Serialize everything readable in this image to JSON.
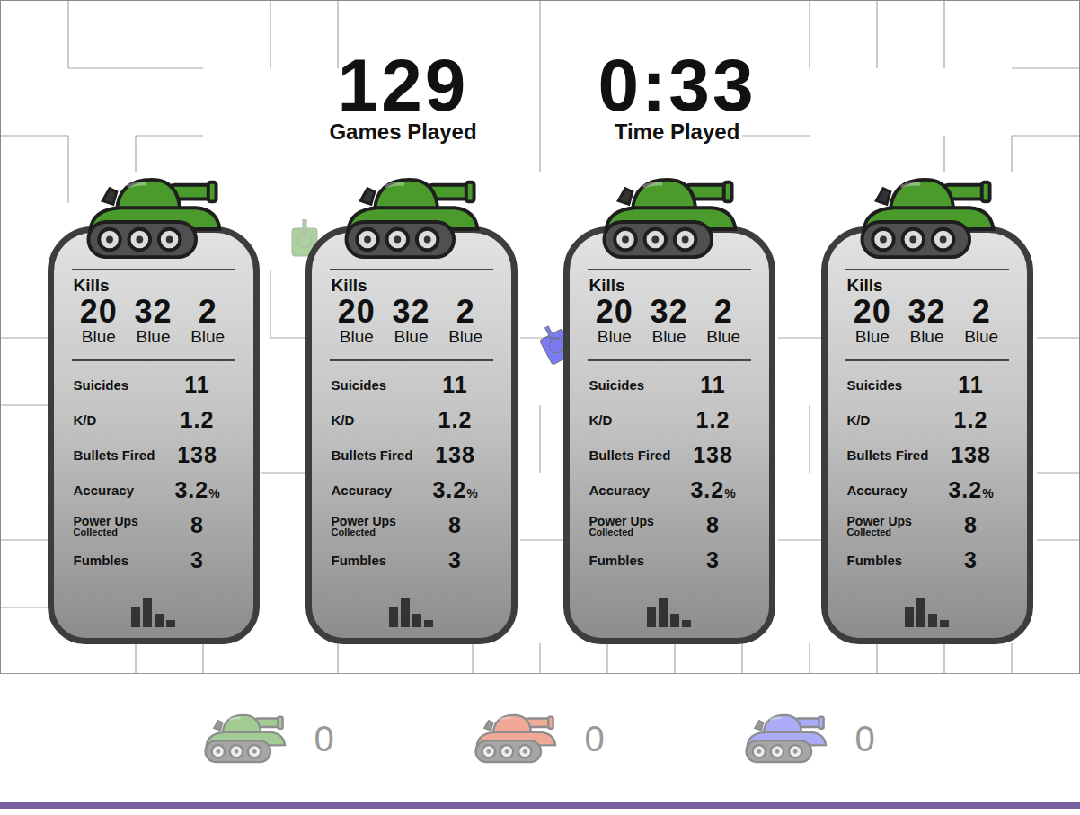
{
  "header": {
    "games_played": {
      "value": "129",
      "label": "Games Played"
    },
    "time_played": {
      "value": "0:33",
      "label": "Time Played"
    }
  },
  "players": [
    {
      "color": "#4a9a2c",
      "kills_label": "Kills",
      "kills": [
        {
          "count": "20",
          "name": "Blue"
        },
        {
          "count": "32",
          "name": "Blue"
        },
        {
          "count": "2",
          "name": "Blue"
        }
      ],
      "stats": [
        {
          "label": "Suicides",
          "value": "11"
        },
        {
          "label": "K/D",
          "value": "1.2"
        },
        {
          "label": "Bullets Fired",
          "value": "138"
        },
        {
          "label": "Accuracy",
          "value": "3.2",
          "unit": "%"
        },
        {
          "label": "Power Ups",
          "sublabel": "Collected",
          "value": "8"
        },
        {
          "label": "Fumbles",
          "value": "3"
        }
      ]
    },
    {
      "color": "#4a9a2c",
      "kills_label": "Kills",
      "kills": [
        {
          "count": "20",
          "name": "Blue"
        },
        {
          "count": "32",
          "name": "Blue"
        },
        {
          "count": "2",
          "name": "Blue"
        }
      ],
      "stats": [
        {
          "label": "Suicides",
          "value": "11"
        },
        {
          "label": "K/D",
          "value": "1.2"
        },
        {
          "label": "Bullets Fired",
          "value": "138"
        },
        {
          "label": "Accuracy",
          "value": "3.2",
          "unit": "%"
        },
        {
          "label": "Power Ups",
          "sublabel": "Collected",
          "value": "8"
        },
        {
          "label": "Fumbles",
          "value": "3"
        }
      ]
    },
    {
      "color": "#4a9a2c",
      "kills_label": "Kills",
      "kills": [
        {
          "count": "20",
          "name": "Blue"
        },
        {
          "count": "32",
          "name": "Blue"
        },
        {
          "count": "2",
          "name": "Blue"
        }
      ],
      "stats": [
        {
          "label": "Suicides",
          "value": "11"
        },
        {
          "label": "K/D",
          "value": "1.2"
        },
        {
          "label": "Bullets Fired",
          "value": "138"
        },
        {
          "label": "Accuracy",
          "value": "3.2",
          "unit": "%"
        },
        {
          "label": "Power Ups",
          "sublabel": "Collected",
          "value": "8"
        },
        {
          "label": "Fumbles",
          "value": "3"
        }
      ]
    },
    {
      "color": "#4a9a2c",
      "kills_label": "Kills",
      "kills": [
        {
          "count": "20",
          "name": "Blue"
        },
        {
          "count": "32",
          "name": "Blue"
        },
        {
          "count": "2",
          "name": "Blue"
        }
      ],
      "stats": [
        {
          "label": "Suicides",
          "value": "11"
        },
        {
          "label": "K/D",
          "value": "1.2"
        },
        {
          "label": "Bullets Fired",
          "value": "138"
        },
        {
          "label": "Accuracy",
          "value": "3.2",
          "unit": "%"
        },
        {
          "label": "Power Ups",
          "sublabel": "Collected",
          "value": "8"
        },
        {
          "label": "Fumbles",
          "value": "3"
        }
      ]
    }
  ],
  "scoreboard": [
    {
      "color": "#4a9a2c",
      "score": "0"
    },
    {
      "color": "#e0552f",
      "score": "0"
    },
    {
      "color": "#5a5af0",
      "score": "0"
    }
  ]
}
